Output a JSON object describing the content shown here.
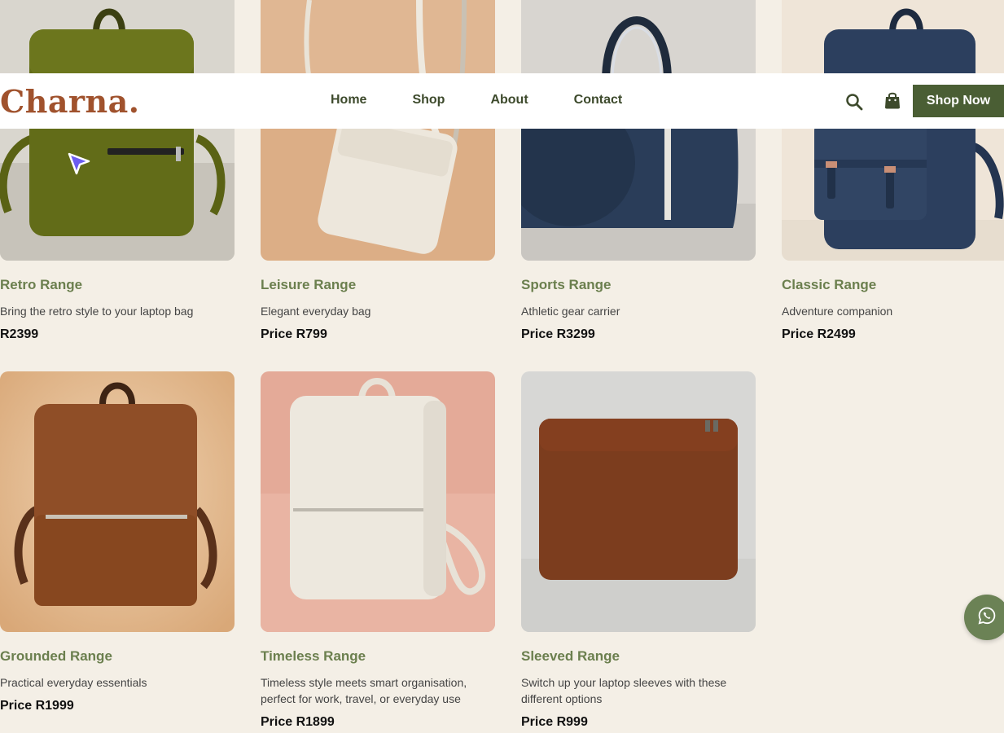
{
  "header": {
    "logo": "Charna.",
    "nav": [
      "Home",
      "Shop",
      "About",
      "Contact"
    ],
    "cta": "Shop Now"
  },
  "products": [
    {
      "title": "Retro Range",
      "desc": "Bring the retro style to your laptop bag",
      "price": "R2399",
      "image": "olive-green-leather-backpack"
    },
    {
      "title": "Leisure Range",
      "desc": "Elegant everyday bag",
      "price": "Price R799",
      "image": "cream-crossbody-bag"
    },
    {
      "title": "Sports Range",
      "desc": "Athletic gear carrier",
      "price": "Price R3299",
      "image": "navy-sports-tote"
    },
    {
      "title": "Classic Range",
      "desc": "Adventure companion",
      "price": "Price R2499",
      "image": "navy-leather-backpack"
    },
    {
      "title": "Grounded Range",
      "desc": "Practical everyday essentials",
      "price": "Price R1999",
      "image": "brown-leather-backpack"
    },
    {
      "title": "Timeless Range",
      "desc": "Timeless style meets smart organisation, perfect for work, travel, or everyday use",
      "price": "Price R1899",
      "image": "white-leather-backpack"
    },
    {
      "title": "Sleeved Range",
      "desc": "Switch up your laptop sleeves with these different options",
      "price": "Price R999",
      "image": "brown-laptop-sleeve"
    }
  ],
  "colors": {
    "background": "#f4efe6",
    "accent": "#4a5e34",
    "logo": "#a0522d",
    "title": "#6b7f4e"
  }
}
